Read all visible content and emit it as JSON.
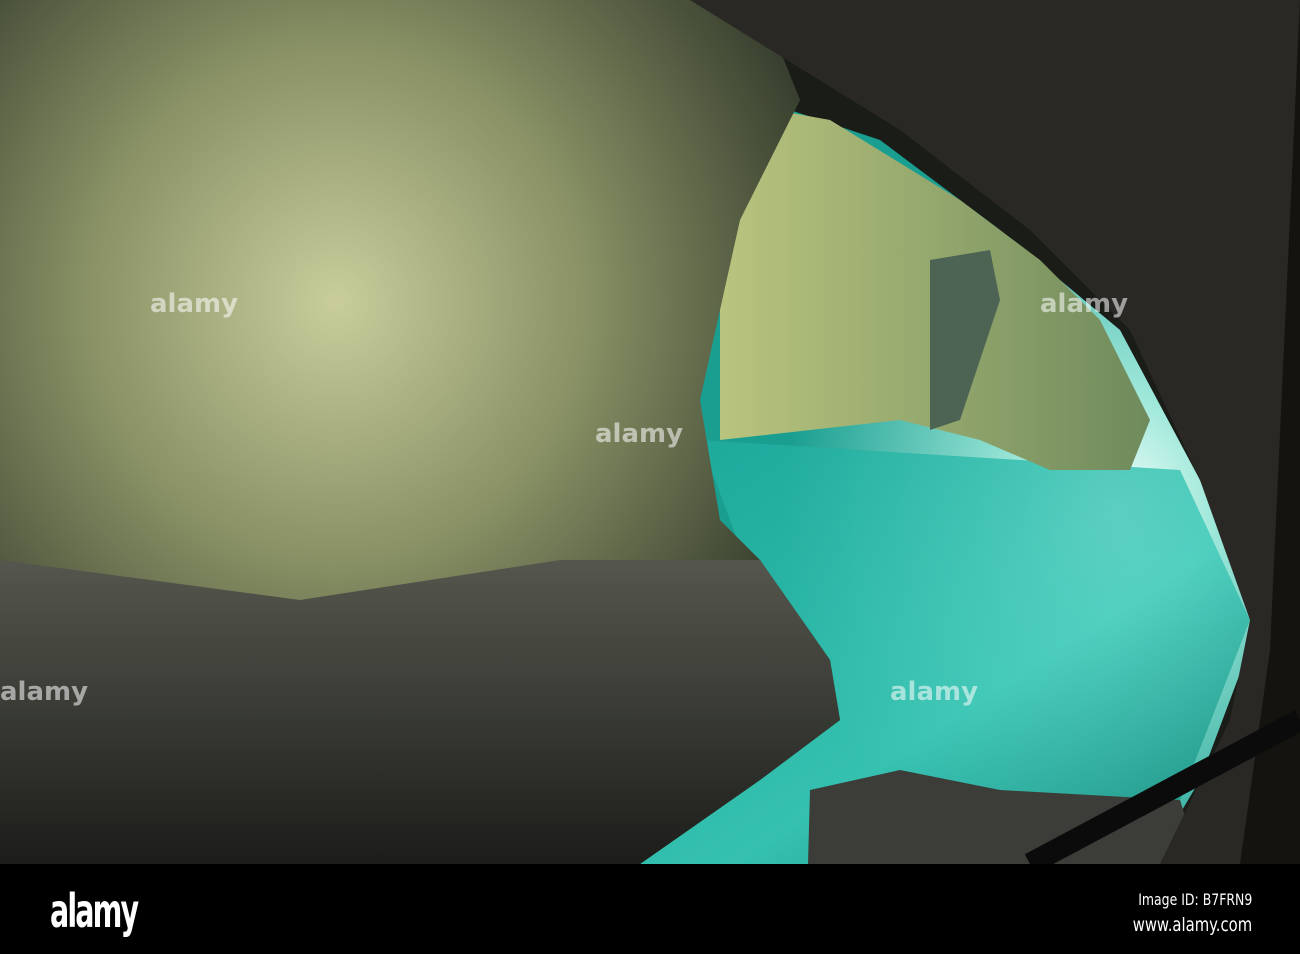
{
  "photo": {
    "subject": "sea cave grotto",
    "watermark": "alamy",
    "colors": {
      "water": "#2fc0b0",
      "rock_light": "#b8c08a",
      "rock_dark": "#2a2c26",
      "opening": "#f2fbf8"
    }
  },
  "footer": {
    "logo": "alamy",
    "image_id": "Image ID: B7FRN9",
    "url": "www.alamy.com"
  }
}
